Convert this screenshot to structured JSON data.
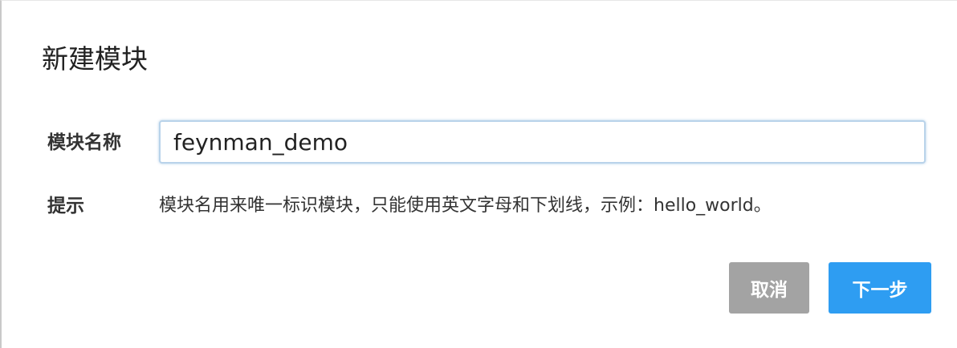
{
  "dialog": {
    "title": "新建模块",
    "name_label": "模块名称",
    "name_value": "feynman_demo",
    "hint_label": "提示",
    "hint_text": "模块名用来唯一标识模块，只能使用英文字母和下划线，示例：hello_world。",
    "cancel_label": "取消",
    "next_label": "下一步"
  },
  "colors": {
    "primary": "#2e9df2",
    "secondary": "#a3a3a3"
  }
}
